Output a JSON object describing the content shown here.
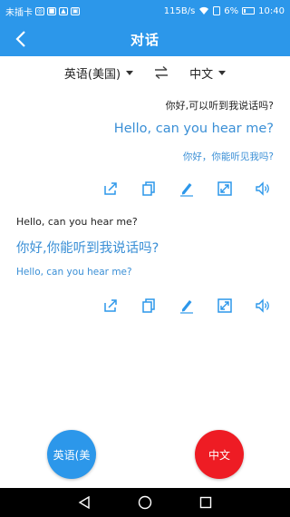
{
  "status_bar": {
    "carrier": "未插卡",
    "speed": "115B/s",
    "battery": "6%",
    "time": "10:40"
  },
  "header": {
    "title": "对话"
  },
  "languages": {
    "source": "英语(美国)",
    "target": "中文"
  },
  "conversation": [
    {
      "align": "right",
      "source_text": "你好,可以听到我说话吗?",
      "translation": "Hello, can you hear me?",
      "back_translation": "你好，你能听见我吗?"
    },
    {
      "align": "left",
      "source_text": "Hello, can you hear me?",
      "translation": "你好,你能听到我说话吗?",
      "back_translation": "Hello, can you hear me?"
    }
  ],
  "buttons": {
    "english_label": "英语(美",
    "chinese_label": "中文"
  },
  "colors": {
    "primary": "#2c97ea",
    "translation_text": "#3a8fd6",
    "record_chinese": "#ee1c24"
  },
  "action_icons": [
    "share-icon",
    "copy-icon",
    "edit-icon",
    "fullscreen-icon",
    "speaker-icon"
  ]
}
